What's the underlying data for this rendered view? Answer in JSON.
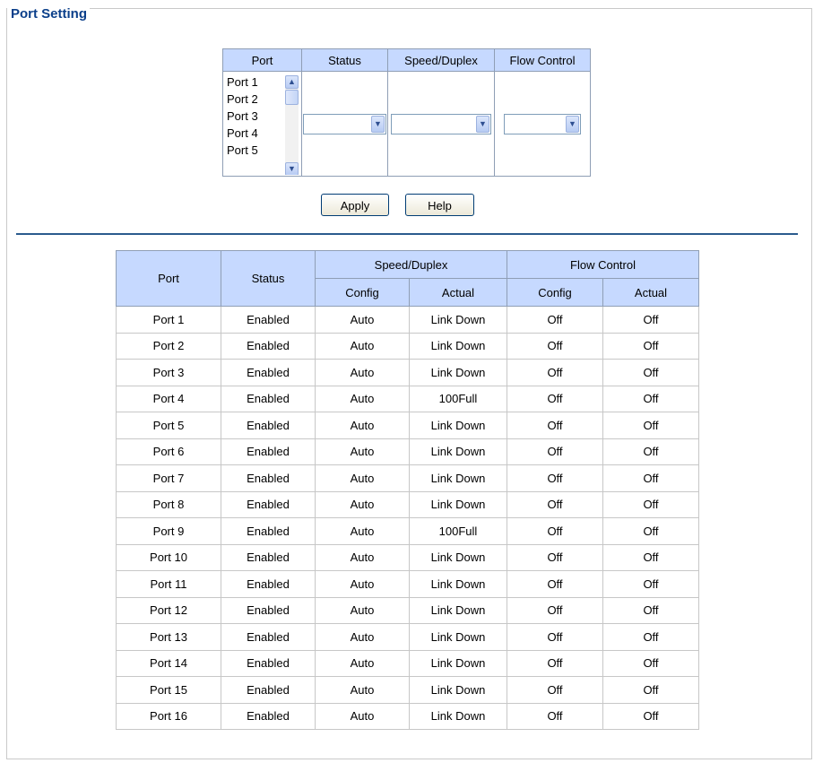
{
  "section": {
    "title": "Port Setting"
  },
  "config": {
    "headers": {
      "port": "Port",
      "status": "Status",
      "speed": "Speed/Duplex",
      "flow": "Flow Control"
    },
    "port_list": [
      "Port 1",
      "Port 2",
      "Port 3",
      "Port 4",
      "Port 5"
    ],
    "status_value": "",
    "speed_value": "",
    "flow_value": ""
  },
  "buttons": {
    "apply": "Apply",
    "help": "Help"
  },
  "status_table": {
    "headers": {
      "port": "Port",
      "status": "Status",
      "speed": "Speed/Duplex",
      "flow": "Flow Control",
      "speed_config": "Config",
      "speed_actual": "Actual",
      "flow_config": "Config",
      "flow_actual": "Actual"
    },
    "rows": [
      [
        "Port 1",
        "Enabled",
        "Auto",
        "Link Down",
        "Off",
        "Off"
      ],
      [
        "Port 2",
        "Enabled",
        "Auto",
        "Link Down",
        "Off",
        "Off"
      ],
      [
        "Port 3",
        "Enabled",
        "Auto",
        "Link Down",
        "Off",
        "Off"
      ],
      [
        "Port 4",
        "Enabled",
        "Auto",
        "100Full",
        "Off",
        "Off"
      ],
      [
        "Port 5",
        "Enabled",
        "Auto",
        "Link Down",
        "Off",
        "Off"
      ],
      [
        "Port 6",
        "Enabled",
        "Auto",
        "Link Down",
        "Off",
        "Off"
      ],
      [
        "Port 7",
        "Enabled",
        "Auto",
        "Link Down",
        "Off",
        "Off"
      ],
      [
        "Port 8",
        "Enabled",
        "Auto",
        "Link Down",
        "Off",
        "Off"
      ],
      [
        "Port 9",
        "Enabled",
        "Auto",
        "100Full",
        "Off",
        "Off"
      ],
      [
        "Port 10",
        "Enabled",
        "Auto",
        "Link Down",
        "Off",
        "Off"
      ],
      [
        "Port 11",
        "Enabled",
        "Auto",
        "Link Down",
        "Off",
        "Off"
      ],
      [
        "Port 12",
        "Enabled",
        "Auto",
        "Link Down",
        "Off",
        "Off"
      ],
      [
        "Port 13",
        "Enabled",
        "Auto",
        "Link Down",
        "Off",
        "Off"
      ],
      [
        "Port 14",
        "Enabled",
        "Auto",
        "Link Down",
        "Off",
        "Off"
      ],
      [
        "Port 15",
        "Enabled",
        "Auto",
        "Link Down",
        "Off",
        "Off"
      ],
      [
        "Port 16",
        "Enabled",
        "Auto",
        "Link Down",
        "Off",
        "Off"
      ]
    ]
  },
  "colors": {
    "header_bg": "#c6d9ff",
    "title": "#0b3f8a",
    "divider": "#2b5b8d"
  },
  "icons": {
    "scroll_up": "chevron-up-icon",
    "scroll_down": "chevron-down-icon",
    "dropdown": "chevron-down-icon"
  }
}
